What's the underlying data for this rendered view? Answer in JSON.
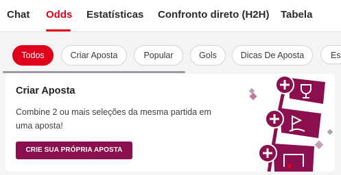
{
  "tabs": [
    {
      "label": "Chat"
    },
    {
      "label": "Odds",
      "active": true
    },
    {
      "label": "Estatísticas"
    },
    {
      "label": "Confronto direto (H2H)"
    },
    {
      "label": "Tabela"
    }
  ],
  "filters": [
    {
      "label": "Todos",
      "active": true
    },
    {
      "label": "Criar Aposta"
    },
    {
      "label": "Popular"
    },
    {
      "label": "Gols"
    },
    {
      "label": "Dicas De Aposta"
    },
    {
      "label": "Es"
    }
  ],
  "card": {
    "title": "Criar Aposta",
    "description": "Combine 2 ou mais seleções da mesma partida em uma aposta!",
    "cta_label": "CRIE SUA PRÓPRIA APOSTA"
  },
  "colors": {
    "accent": "#e1001b",
    "brand": "#8b0f4e"
  }
}
